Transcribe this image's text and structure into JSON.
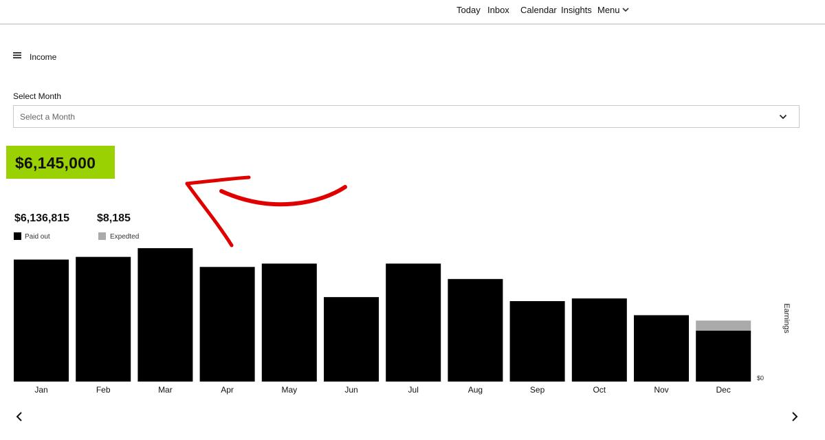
{
  "nav": {
    "links": [
      "Today",
      "Inbox",
      "Calendar",
      "Insights",
      "Menu"
    ],
    "menu_icon": "chevron-down-icon"
  },
  "header": {
    "title": "Income",
    "menu_icon": "hamburger-icon"
  },
  "month_select": {
    "label": "Select Month",
    "placeholder": "Select a Month",
    "icon": "chevron-down-icon"
  },
  "total": {
    "value": "$6,145,000",
    "highlight_color": "#99d102"
  },
  "annotation": {
    "icon": "red-arrow-icon",
    "color": "#e00000"
  },
  "summary": {
    "paid_out": {
      "value": "$6,136,815",
      "label": "Paid out",
      "color": "#000000"
    },
    "expected": {
      "value": "$8,185",
      "label": "Expedted",
      "color": "#aaaaaa"
    }
  },
  "chart_data": {
    "type": "bar",
    "stacked": true,
    "categories": [
      "Jan",
      "Feb",
      "Mar",
      "Apr",
      "May",
      "Jun",
      "Jul",
      "Aug",
      "Sep",
      "Oct",
      "Nov",
      "Dec"
    ],
    "series": [
      {
        "name": "Paid out",
        "color": "#000000",
        "values": [
          182,
          186,
          199,
          171,
          176,
          126,
          176,
          153,
          120,
          124,
          99,
          76
        ]
      },
      {
        "name": "Expedted",
        "color": "#aaaaaa",
        "values": [
          0,
          0,
          0,
          0,
          0,
          0,
          0,
          0,
          0,
          0,
          0,
          15
        ]
      }
    ],
    "ylabel": "Earnings",
    "y_tick_labels": [
      "$0"
    ],
    "ylim": [
      0,
      200
    ],
    "grid": false,
    "legend": "top-left"
  },
  "pager": {
    "prev_icon": "chevron-left-icon",
    "next_icon": "chevron-right-icon"
  }
}
